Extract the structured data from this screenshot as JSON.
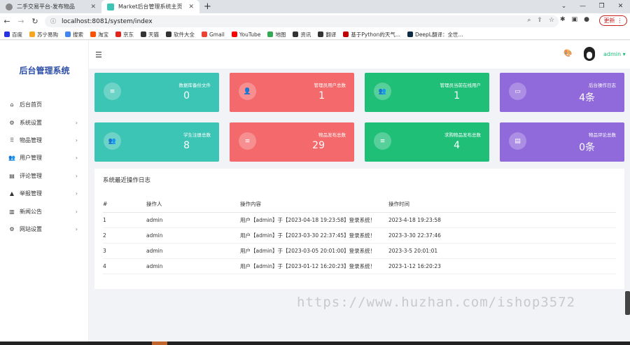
{
  "browser": {
    "tabs": [
      {
        "title": "二手交易平台-发布物品",
        "active": false
      },
      {
        "title": "Market后台管理系统主页",
        "active": true
      }
    ],
    "url": "localhost:8081/system/index",
    "update_label": "更新",
    "bookmarks": [
      {
        "label": "百度",
        "color": "#2932e1"
      },
      {
        "label": "苏宁易购",
        "color": "#f5a623"
      },
      {
        "label": "搜索",
        "color": "#4285f4"
      },
      {
        "label": "淘宝",
        "color": "#ff5000"
      },
      {
        "label": "京东",
        "color": "#e1251b"
      },
      {
        "label": "天猫",
        "color": "#333333"
      },
      {
        "label": "软件大全",
        "color": "#333333"
      },
      {
        "label": "Gmail",
        "color": "#ea4335"
      },
      {
        "label": "YouTube",
        "color": "#ff0000"
      },
      {
        "label": "地图",
        "color": "#34a853"
      },
      {
        "label": "资讯",
        "color": "#333333"
      },
      {
        "label": "翻译",
        "color": "#333333"
      },
      {
        "label": "基于Python的天气...",
        "color": "#c00000"
      },
      {
        "label": "DeepL翻译：全世...",
        "color": "#0f2b46"
      }
    ]
  },
  "sidebar": {
    "brand": "后台管理系统",
    "items": [
      {
        "label": "后台首页",
        "icon": "home-icon",
        "arrow": false
      },
      {
        "label": "系统设置",
        "icon": "gear-icon",
        "arrow": true
      },
      {
        "label": "物品管理",
        "icon": "grid-icon",
        "arrow": true
      },
      {
        "label": "用户管理",
        "icon": "users-icon",
        "arrow": true
      },
      {
        "label": "评论管理",
        "icon": "comment-icon",
        "arrow": true
      },
      {
        "label": "举报管理",
        "icon": "warning-icon",
        "arrow": true
      },
      {
        "label": "新闻公告",
        "icon": "news-icon",
        "arrow": true
      },
      {
        "label": "网站设置",
        "icon": "gear-icon",
        "arrow": true
      }
    ]
  },
  "topbar": {
    "user": "admin ▾"
  },
  "cards": [
    {
      "label": "数据库备份文件",
      "value": "0",
      "color": "#3cc5b5",
      "icon": "database-icon"
    },
    {
      "label": "管理员用户总数",
      "value": "1",
      "color": "#f4696b",
      "icon": "user-icon"
    },
    {
      "label": "管理员当前在线用户",
      "value": "1",
      "color": "#1fbf78",
      "icon": "users-icon"
    },
    {
      "label": "后台操作日志",
      "value": "4条",
      "color": "#9069db",
      "icon": "log-icon"
    },
    {
      "label": "学生注册总数",
      "value": "8",
      "color": "#3cc5b5",
      "icon": "users-icon"
    },
    {
      "label": "物品发布总数",
      "value": "29",
      "color": "#f4696b",
      "icon": "database-icon"
    },
    {
      "label": "求购物品发布总数",
      "value": "4",
      "color": "#1fbf78",
      "icon": "database-icon"
    },
    {
      "label": "物品评论总数",
      "value": "0条",
      "color": "#9069db",
      "icon": "comment-icon"
    }
  ],
  "log_panel": {
    "title": "系统最近操作日志",
    "headers": [
      "#",
      "操作人",
      "操作内容",
      "操作时间"
    ],
    "rows": [
      [
        "1",
        "admin",
        "用户【admin】于【2023-04-18 19:23:58】登录系统！",
        "2023-4-18 19:23:58"
      ],
      [
        "2",
        "admin",
        "用户【admin】于【2023-03-30 22:37:45】登录系统！",
        "2023-3-30 22:37:46"
      ],
      [
        "3",
        "admin",
        "用户【admin】于【2023-03-05 20:01:00】登录系统！",
        "2023-3-5 20:01:01"
      ],
      [
        "4",
        "admin",
        "用户【admin】于【2023-01-12 16:20:23】登录系统！",
        "2023-1-12 16:20:23"
      ]
    ]
  },
  "watermark": "https://www.huzhan.com/ishop3572"
}
